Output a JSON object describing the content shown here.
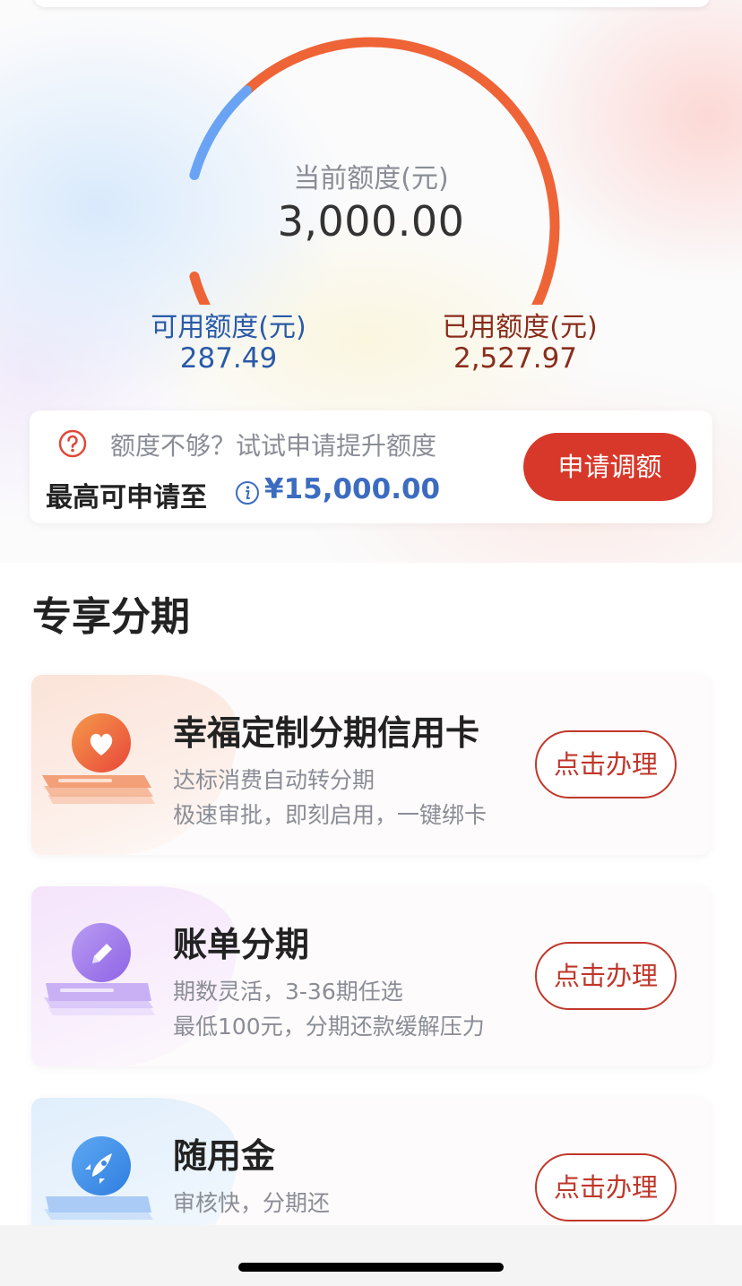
{
  "credit": {
    "current_label": "当前额度(元)",
    "current_value": "3,000.00",
    "available_label": "可用额度(元)",
    "available_value": "287.49",
    "used_label": "已用额度(元)",
    "used_value": "2,527.97",
    "available_ratio": 0.096
  },
  "raise": {
    "tip": "额度不够？试试申请提升额度",
    "max_label": "最高可申请至",
    "max_value": "¥15,000.00",
    "button_label": "申请调额"
  },
  "section": {
    "title": "专享分期"
  },
  "products": [
    {
      "title": "幸福定制分期信用卡",
      "line1": "达标消费自动转分期",
      "line2": "极速审批，即刻启用，一键绑卡",
      "button_label": "点击办理",
      "icon": "heart-icon"
    },
    {
      "title": "账单分期",
      "line1": "期数灵活，3-36期任选",
      "line2": "最低100元，分期还款缓解压力",
      "button_label": "点击办理",
      "icon": "pencil-icon"
    },
    {
      "title": "随用金",
      "line1": "审核快，分期还",
      "line2": "",
      "button_label": "点击办理",
      "icon": "rocket-icon"
    }
  ],
  "colors": {
    "gauge_used": "#ee6436",
    "gauge_available": "#6aa3f3",
    "primary_red": "#d8382a",
    "link_blue": "#3c6cc0"
  }
}
